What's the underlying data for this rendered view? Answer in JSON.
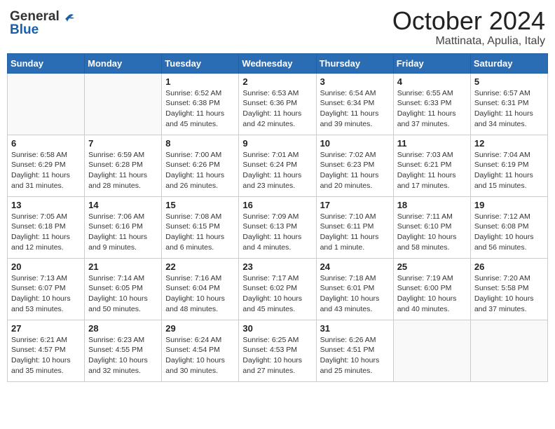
{
  "header": {
    "logo_general": "General",
    "logo_blue": "Blue",
    "month": "October 2024",
    "location": "Mattinata, Apulia, Italy"
  },
  "days_of_week": [
    "Sunday",
    "Monday",
    "Tuesday",
    "Wednesday",
    "Thursday",
    "Friday",
    "Saturday"
  ],
  "weeks": [
    [
      {
        "day": "",
        "info": ""
      },
      {
        "day": "",
        "info": ""
      },
      {
        "day": "1",
        "info": "Sunrise: 6:52 AM\nSunset: 6:38 PM\nDaylight: 11 hours and 45 minutes."
      },
      {
        "day": "2",
        "info": "Sunrise: 6:53 AM\nSunset: 6:36 PM\nDaylight: 11 hours and 42 minutes."
      },
      {
        "day": "3",
        "info": "Sunrise: 6:54 AM\nSunset: 6:34 PM\nDaylight: 11 hours and 39 minutes."
      },
      {
        "day": "4",
        "info": "Sunrise: 6:55 AM\nSunset: 6:33 PM\nDaylight: 11 hours and 37 minutes."
      },
      {
        "day": "5",
        "info": "Sunrise: 6:57 AM\nSunset: 6:31 PM\nDaylight: 11 hours and 34 minutes."
      }
    ],
    [
      {
        "day": "6",
        "info": "Sunrise: 6:58 AM\nSunset: 6:29 PM\nDaylight: 11 hours and 31 minutes."
      },
      {
        "day": "7",
        "info": "Sunrise: 6:59 AM\nSunset: 6:28 PM\nDaylight: 11 hours and 28 minutes."
      },
      {
        "day": "8",
        "info": "Sunrise: 7:00 AM\nSunset: 6:26 PM\nDaylight: 11 hours and 26 minutes."
      },
      {
        "day": "9",
        "info": "Sunrise: 7:01 AM\nSunset: 6:24 PM\nDaylight: 11 hours and 23 minutes."
      },
      {
        "day": "10",
        "info": "Sunrise: 7:02 AM\nSunset: 6:23 PM\nDaylight: 11 hours and 20 minutes."
      },
      {
        "day": "11",
        "info": "Sunrise: 7:03 AM\nSunset: 6:21 PM\nDaylight: 11 hours and 17 minutes."
      },
      {
        "day": "12",
        "info": "Sunrise: 7:04 AM\nSunset: 6:19 PM\nDaylight: 11 hours and 15 minutes."
      }
    ],
    [
      {
        "day": "13",
        "info": "Sunrise: 7:05 AM\nSunset: 6:18 PM\nDaylight: 11 hours and 12 minutes."
      },
      {
        "day": "14",
        "info": "Sunrise: 7:06 AM\nSunset: 6:16 PM\nDaylight: 11 hours and 9 minutes."
      },
      {
        "day": "15",
        "info": "Sunrise: 7:08 AM\nSunset: 6:15 PM\nDaylight: 11 hours and 6 minutes."
      },
      {
        "day": "16",
        "info": "Sunrise: 7:09 AM\nSunset: 6:13 PM\nDaylight: 11 hours and 4 minutes."
      },
      {
        "day": "17",
        "info": "Sunrise: 7:10 AM\nSunset: 6:11 PM\nDaylight: 11 hours and 1 minute."
      },
      {
        "day": "18",
        "info": "Sunrise: 7:11 AM\nSunset: 6:10 PM\nDaylight: 10 hours and 58 minutes."
      },
      {
        "day": "19",
        "info": "Sunrise: 7:12 AM\nSunset: 6:08 PM\nDaylight: 10 hours and 56 minutes."
      }
    ],
    [
      {
        "day": "20",
        "info": "Sunrise: 7:13 AM\nSunset: 6:07 PM\nDaylight: 10 hours and 53 minutes."
      },
      {
        "day": "21",
        "info": "Sunrise: 7:14 AM\nSunset: 6:05 PM\nDaylight: 10 hours and 50 minutes."
      },
      {
        "day": "22",
        "info": "Sunrise: 7:16 AM\nSunset: 6:04 PM\nDaylight: 10 hours and 48 minutes."
      },
      {
        "day": "23",
        "info": "Sunrise: 7:17 AM\nSunset: 6:02 PM\nDaylight: 10 hours and 45 minutes."
      },
      {
        "day": "24",
        "info": "Sunrise: 7:18 AM\nSunset: 6:01 PM\nDaylight: 10 hours and 43 minutes."
      },
      {
        "day": "25",
        "info": "Sunrise: 7:19 AM\nSunset: 6:00 PM\nDaylight: 10 hours and 40 minutes."
      },
      {
        "day": "26",
        "info": "Sunrise: 7:20 AM\nSunset: 5:58 PM\nDaylight: 10 hours and 37 minutes."
      }
    ],
    [
      {
        "day": "27",
        "info": "Sunrise: 6:21 AM\nSunset: 4:57 PM\nDaylight: 10 hours and 35 minutes."
      },
      {
        "day": "28",
        "info": "Sunrise: 6:23 AM\nSunset: 4:55 PM\nDaylight: 10 hours and 32 minutes."
      },
      {
        "day": "29",
        "info": "Sunrise: 6:24 AM\nSunset: 4:54 PM\nDaylight: 10 hours and 30 minutes."
      },
      {
        "day": "30",
        "info": "Sunrise: 6:25 AM\nSunset: 4:53 PM\nDaylight: 10 hours and 27 minutes."
      },
      {
        "day": "31",
        "info": "Sunrise: 6:26 AM\nSunset: 4:51 PM\nDaylight: 10 hours and 25 minutes."
      },
      {
        "day": "",
        "info": ""
      },
      {
        "day": "",
        "info": ""
      }
    ]
  ]
}
